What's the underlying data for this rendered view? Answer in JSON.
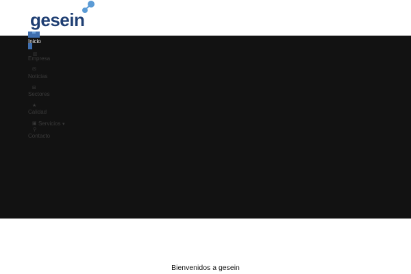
{
  "brand": {
    "name": "gesein",
    "primary_color": "#1f3f73",
    "accent_color": "#5b9bd5"
  },
  "nav": {
    "items": [
      {
        "label": "Inicio",
        "icon": "home-icon",
        "active": true
      },
      {
        "label": "Empresa",
        "icon": "building-icon",
        "active": false
      },
      {
        "label": "Noticias",
        "icon": "envelope-icon",
        "active": false
      },
      {
        "label": "Sectores",
        "icon": "grid-icon",
        "active": false
      },
      {
        "label": "Calidad",
        "icon": "star-icon",
        "active": false
      },
      {
        "label": "Servicios",
        "icon": "briefcase-icon",
        "active": false,
        "has_dropdown": true
      },
      {
        "label": "Contacto",
        "icon": "map-pin-icon",
        "active": false
      }
    ]
  },
  "hero": {
    "background_color": "#121212"
  },
  "main": {
    "welcome_title": "Bienvenidos a gesein"
  }
}
